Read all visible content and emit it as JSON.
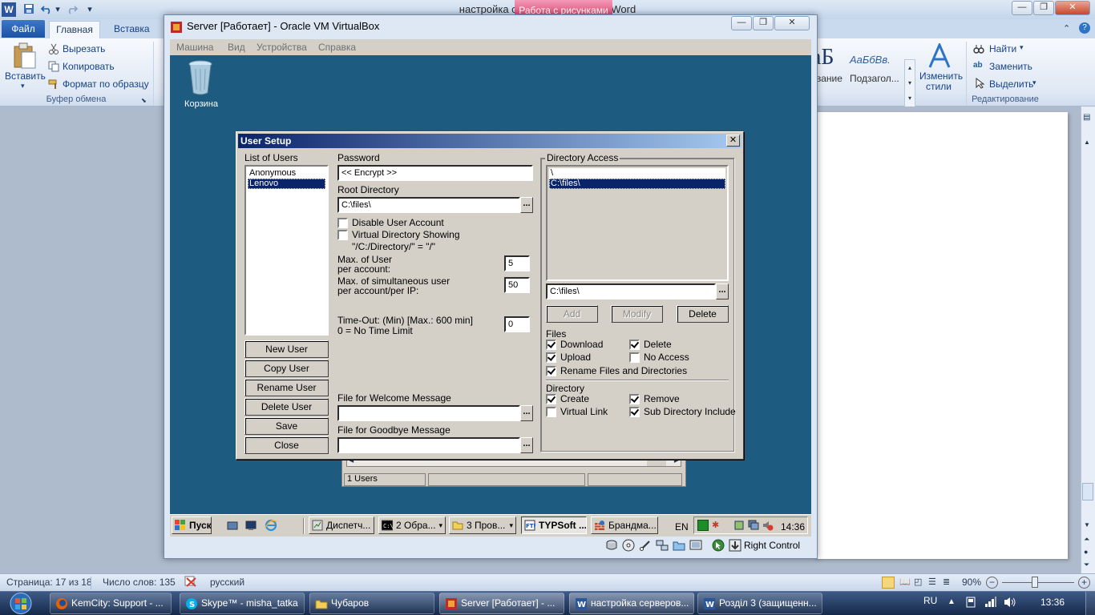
{
  "word": {
    "title": "настройка серверов - Microsoft Word",
    "contextual_tab": "Работа с рисунками",
    "tabs": {
      "file": "Файл",
      "home": "Главная",
      "insert": "Вставка"
    },
    "clipboard": {
      "paste": "Вставить",
      "cut": "Вырезать",
      "copy": "Копировать",
      "format_painter": "Формат по образцу",
      "group_label": "Буфер обмена"
    },
    "styles": {
      "preview_1": "аБ",
      "preview_2": "АаБбВв.",
      "label_1": "вание",
      "label_2": "Подзагол...",
      "change_styles": "Изменить",
      "change_styles_2": "стили"
    },
    "editing": {
      "find": "Найти",
      "replace": "Заменить",
      "select": "Выделить",
      "group_label": "Редактирование"
    },
    "status": {
      "page": "Страница: 17 из 18",
      "words": "Число слов: 135",
      "language": "русский",
      "zoom": "90%"
    }
  },
  "vbox": {
    "title": "Server [Работает] - Oracle VM VirtualBox",
    "menu": [
      "Машина",
      "Вид",
      "Устройства",
      "Справка"
    ],
    "host_key": "Right Control"
  },
  "guest": {
    "recycle_bin": "Корзина",
    "bg_status": "1 Users",
    "taskbar": {
      "start": "Пуск",
      "items": [
        "Диспетч...",
        "2 Обра...",
        "3 Пров...",
        "TYPSoft ...",
        "Брандма..."
      ],
      "lang": "EN",
      "clock": "14:36"
    }
  },
  "dialog": {
    "title": "User Setup",
    "users_label": "List of Users",
    "users": [
      "Anonymous",
      "Lenovo"
    ],
    "buttons": {
      "new_user": "New User",
      "copy_user": "Copy User",
      "rename_user": "Rename User",
      "delete_user": "Delete User",
      "save": "Save",
      "close": "Close"
    },
    "password_label": "Password",
    "password_value": "<< Encrypt >>",
    "root_label": "Root Directory",
    "root_value": "C:\\files\\",
    "disable_account": "Disable User Account",
    "virtual_dir": "Virtual Directory Showing",
    "virtual_dir_hint": "\"/C:/Directory/\" = \"/\"",
    "max_user_label_1": "Max. of User",
    "max_user_label_2": "per account:",
    "max_user_value": "5",
    "max_sim_label_1": "Max. of simultaneous user",
    "max_sim_label_2": "per account/per IP:",
    "max_sim_value": "50",
    "timeout_label_1": "Time-Out: (Min) [Max.: 600 min]",
    "timeout_label_2": "0 = No Time Limit",
    "timeout_value": "0",
    "welcome_label": "File for Welcome Message",
    "goodbye_label": "File for Goodbye Message",
    "dir_access_label": "Directory Access",
    "dir_list": [
      "\\",
      "C:\\files\\"
    ],
    "dir_path": "C:\\files\\",
    "dir_buttons": {
      "add": "Add",
      "modify": "Modify",
      "delete": "Delete"
    },
    "files_label": "Files",
    "files": {
      "download": "Download",
      "delete": "Delete",
      "upload": "Upload",
      "no_access": "No Access",
      "rename": "Rename Files and Directories"
    },
    "directory_label": "Directory",
    "directory": {
      "create": "Create",
      "remove": "Remove",
      "virtual_link": "Virtual Link",
      "subdir_include": "Sub Directory Include"
    }
  },
  "taskbar": {
    "items": [
      "KemCity: Support - ...",
      "Skype™ - misha_tatka",
      "Чубаров",
      "Server [Работает] - ...",
      "настройка серверов...",
      "Розділ 3 (защищенн..."
    ],
    "lang": "RU",
    "clock": "13:36"
  }
}
